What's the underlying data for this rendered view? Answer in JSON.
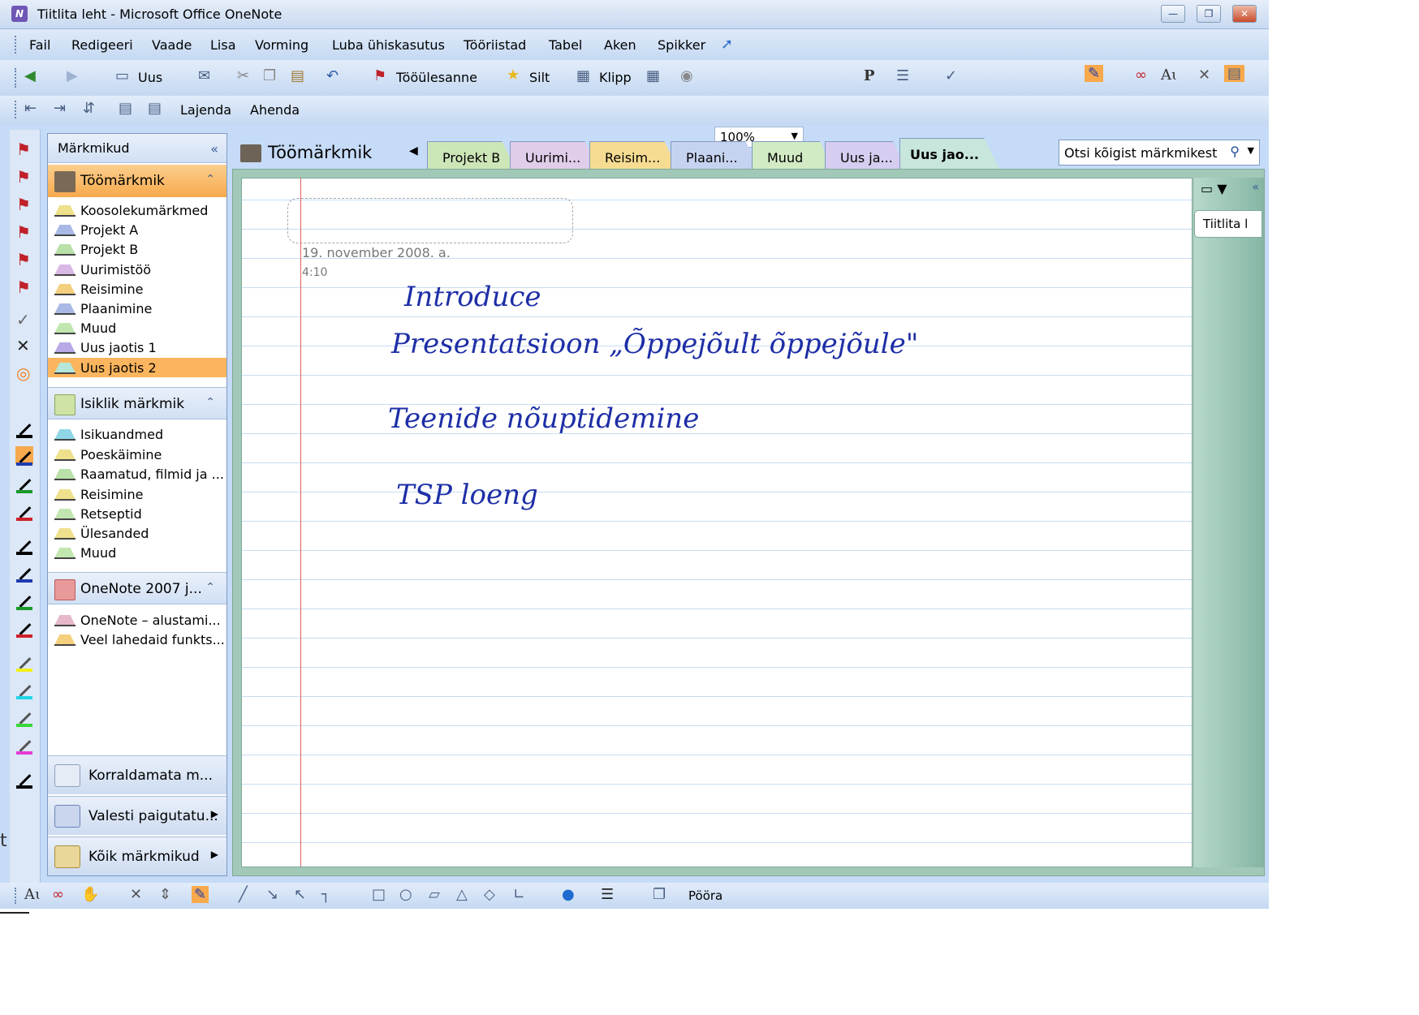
{
  "window": {
    "title": "Tiitlita leht - Microsoft Office OneNote",
    "app_icon": "onenote-icon"
  },
  "menu": [
    "Fail",
    "Redigeeri",
    "Vaade",
    "Lisa",
    "Vorming",
    "Luba ühiskasutus",
    "Tööriistad",
    "Tabel",
    "Aken",
    "Spikker"
  ],
  "toolbar1": {
    "new_label": "Uus",
    "task_label": "Tööülesanne",
    "tag_label": "Silt",
    "clip_label": "Klipp",
    "zoom": "100%"
  },
  "toolbar2": {
    "expand_label": "Lajenda",
    "collapse_label": "Ahenda"
  },
  "nav": {
    "header": "Märkmikud",
    "notebooks": [
      {
        "name": "Töömärkmik",
        "color": "#f7a94c",
        "sections": [
          {
            "name": "Koosolekumärkmed",
            "color": "#efe08c"
          },
          {
            "name": "Projekt A",
            "color": "#a9b9e6"
          },
          {
            "name": "Projekt B",
            "color": "#b8e0a8"
          },
          {
            "name": "Uurimistöö",
            "color": "#d9b8e6"
          },
          {
            "name": "Reisimine",
            "color": "#f4cf7e"
          },
          {
            "name": "Plaanimine",
            "color": "#a9b9e6"
          },
          {
            "name": "Muud",
            "color": "#c2e6b0"
          },
          {
            "name": "Uus jaotis 1",
            "color": "#b9a9e6"
          },
          {
            "name": "Uus jaotis 2",
            "color": "#b5e6da",
            "selected": true
          }
        ]
      },
      {
        "name": "Isiklik märkmik",
        "color": "#cfe3a5",
        "sections": [
          {
            "name": "Isikuandmed",
            "color": "#8fd6e6"
          },
          {
            "name": "Poeskäimine",
            "color": "#efe08c"
          },
          {
            "name": "Raamatud, filmid ja ...",
            "color": "#b8e0a8"
          },
          {
            "name": "Reisimine",
            "color": "#efe08c"
          },
          {
            "name": "Retseptid",
            "color": "#c2e6b0"
          },
          {
            "name": "Ülesanded",
            "color": "#efe08c"
          },
          {
            "name": "Muud",
            "color": "#c2e6b0"
          }
        ]
      },
      {
        "name": "OneNote 2007 j...",
        "color": "#e89a9a",
        "sections": [
          {
            "name": "OneNote – alustami...",
            "color": "#e6b8c9"
          },
          {
            "name": "Veel lahedaid funkts...",
            "color": "#f4cf7e"
          }
        ]
      }
    ],
    "footer": [
      "Korraldamata m...",
      "Valesti paigutatu...",
      "Kõik märkmikud"
    ]
  },
  "main": {
    "notebook_title": "Töömärkmik",
    "tabs": [
      {
        "label": "Projekt B",
        "color": "#cde6b8"
      },
      {
        "label": "Uurimi...",
        "color": "#e0cdea"
      },
      {
        "label": "Reisim...",
        "color": "#f6dc92"
      },
      {
        "label": "Plaani...",
        "color": "#c6d3f0"
      },
      {
        "label": "Muud",
        "color": "#d2ebc4"
      },
      {
        "label": "Uus ja...",
        "color": "#d6cdf0"
      },
      {
        "label": "Uus jao...",
        "color": "#c8e6db",
        "active": true
      }
    ],
    "search_placeholder": "Otsi kõigist märkmikest",
    "page": {
      "date": "19. november 2008. a.",
      "time": "4:10",
      "lines": [
        "Introduce",
        "Presentatsioon „Õppejõult õppejõule\"",
        "Teenide nõuptidemine",
        "TSP loeng"
      ]
    },
    "page_list": [
      "Tiitlita l"
    ]
  },
  "bottom": {
    "rotate_label": "Pööra"
  },
  "edge": {
    "text": "t"
  }
}
